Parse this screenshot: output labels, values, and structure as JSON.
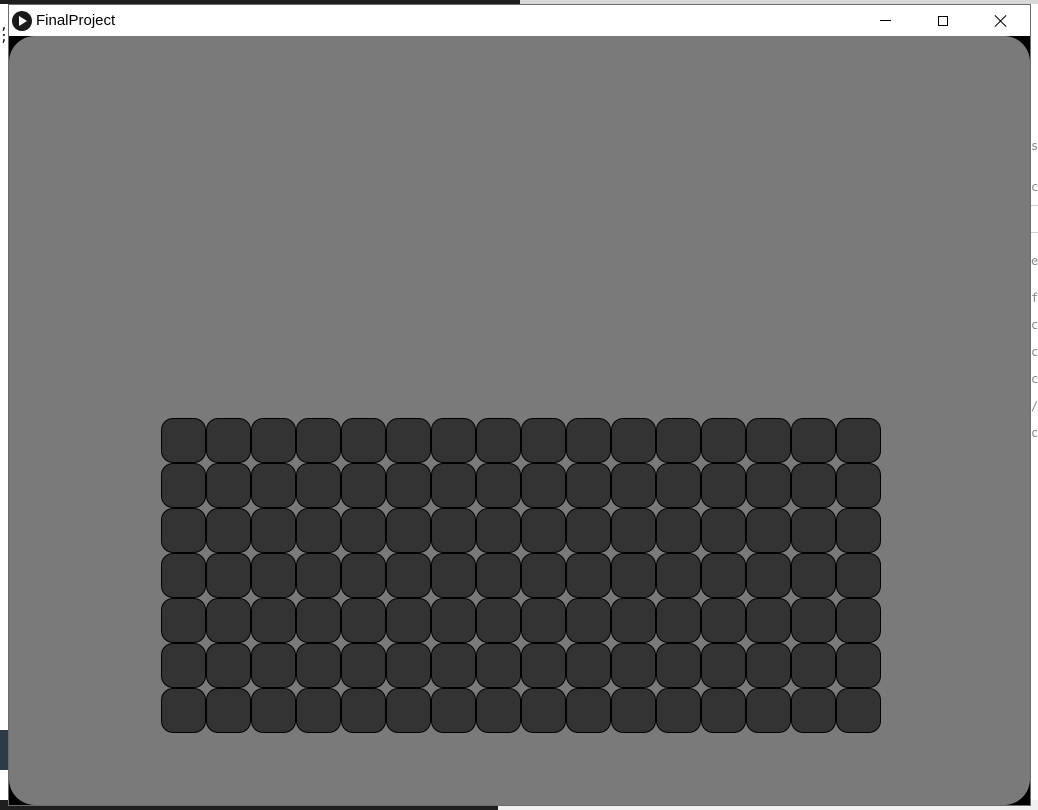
{
  "background": {
    "left_text": ",\n;",
    "right_text_fragments": [
      "s",
      "c",
      "e",
      "f",
      "ce",
      "ce",
      "ce",
      "/",
      "ce"
    ]
  },
  "window": {
    "title": "FinalProject",
    "icon": "play-icon",
    "controls": {
      "minimize_icon": "minimize-icon",
      "maximize_icon": "maximize-icon",
      "close_icon": "close-icon"
    }
  },
  "canvas": {
    "background_color": "#7a7a7a",
    "tile_color": "#333333",
    "tile_border_color": "#000000",
    "grid": {
      "rows": 7,
      "columns": 16
    }
  }
}
